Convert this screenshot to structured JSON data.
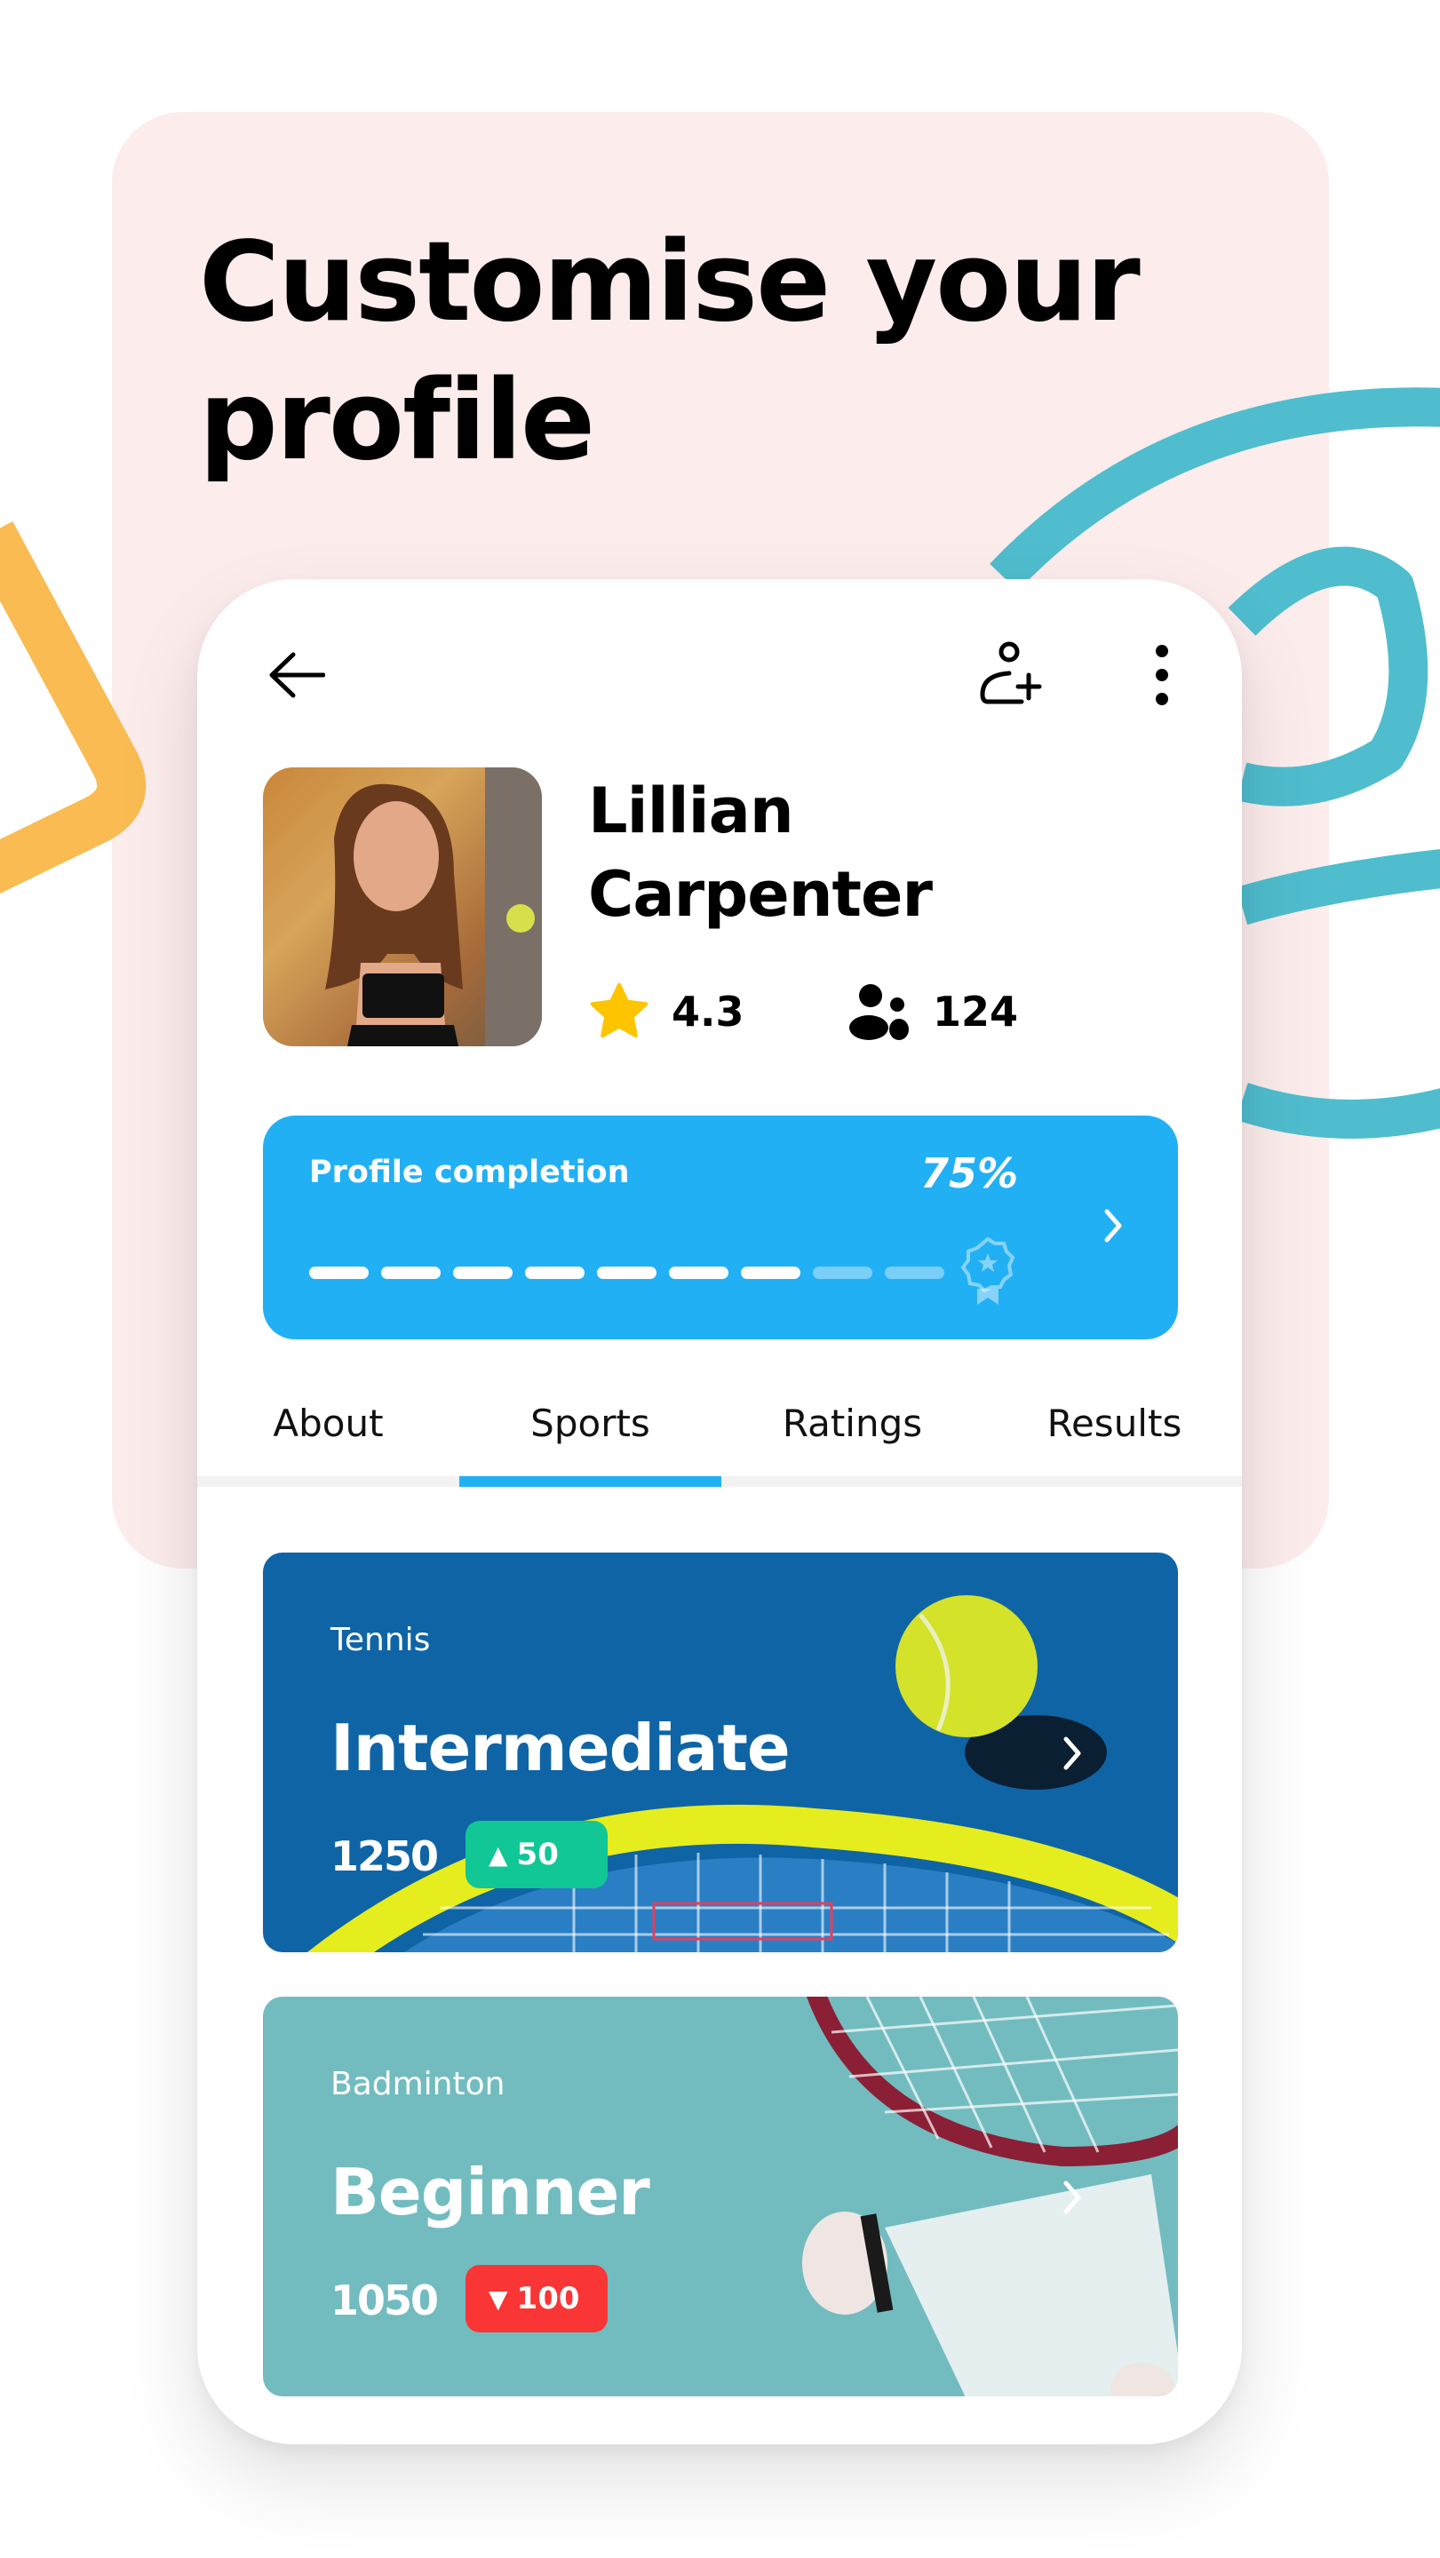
{
  "headline": "Customise your profile",
  "colors": {
    "accent": "#22b0f4",
    "background_panel": "#fdecec",
    "deco_teal": "#4fbdce",
    "deco_yellow": "#f9bb52",
    "star": "#fdc500",
    "up": "#10c795",
    "down": "#fa3535"
  },
  "header": {
    "back_icon": "arrow-left",
    "add_friend_icon": "user-plus",
    "more_icon": "more-vertical"
  },
  "profile": {
    "first_name": "Lillian",
    "last_name": "Carpenter",
    "rating": "4.3",
    "rating_icon": "star",
    "friends_count": "124",
    "friends_icon": "users"
  },
  "completion": {
    "label": "Profile completion",
    "percent_text": "75%",
    "percent": 75,
    "segments_total": 9,
    "segments_filled": 7,
    "badge_icon": "award-ribbon",
    "chevron_icon": "chevron-right"
  },
  "tabs": [
    {
      "label": "About",
      "active": false
    },
    {
      "label": "Sports",
      "active": true
    },
    {
      "label": "Ratings",
      "active": false
    },
    {
      "label": "Results",
      "active": false
    }
  ],
  "sports": [
    {
      "sport": "Tennis",
      "level": "Intermediate",
      "points": "1250",
      "delta": "50",
      "direction": "up",
      "direction_symbol": "▲"
    },
    {
      "sport": "Badminton",
      "level": "Beginner",
      "points": "1050",
      "delta": "100",
      "direction": "down",
      "direction_symbol": "▼"
    }
  ]
}
